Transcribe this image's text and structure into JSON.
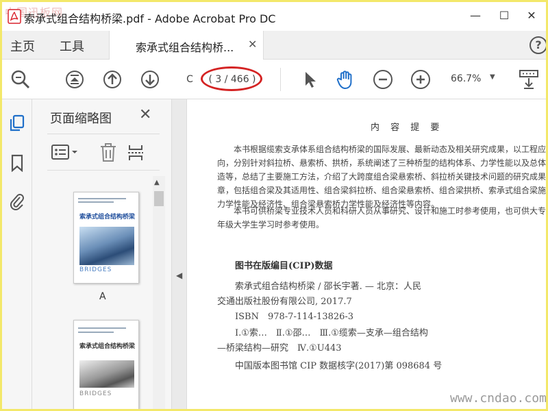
{
  "window": {
    "watermark": "中国迅板网",
    "title": "索承式组合结构桥梁.pdf - Adobe Acrobat Pro DC",
    "minimize": "—",
    "maximize": "☐",
    "close": "✕"
  },
  "tabs": {
    "home": "主页",
    "tools": "工具",
    "document_tab": "索承式组合结构桥...",
    "tab_close": "✕",
    "help": "?"
  },
  "toolbar": {
    "page_input": "C",
    "page_count": "( 3 / 466 )",
    "zoom": "66.7%",
    "zoom_caret": "▼"
  },
  "thumbnails": {
    "title": "页面缩略图",
    "close": "✕",
    "scroll_up": "▲",
    "items": [
      {
        "cover_title": "索承式组合结构桥梁",
        "cover_subtitle": "BRIDGES",
        "label": "A"
      },
      {
        "cover_title": "索承式组合结构桥梁",
        "cover_subtitle": "BRIDGES",
        "label": ""
      }
    ]
  },
  "collapse_arrow": "◀",
  "document": {
    "heading": "内 容 提 要",
    "summary_lines": [
      "　　本书根据缆索支承体系组合结构桥梁的国际发展、最新动态及相关研究成果，以工程应用",
      "向，分别针对斜拉桥、悬索桥、拱桥，系统阐述了三种桥型的结构体系、力学性能以及总体布置、结",
      "造等，总结了主要施工方法，介绍了大跨度组合梁悬索桥、斜拉桥关键技术问题的研究成果。全",
      "章，包括组合梁及其适用性、组合梁斜拉桥、组合梁悬索桥、组合梁拱桥、索承式组合梁施工方法、组",
      "力学性能及经济性、组合梁悬索桥力学性能及经济性等内容。",
      "　　本书可供桥梁专业技术人员和科研人员从事研究、设计和施工时参考使用，也可供大专院校",
      "年级大学生学习时参考使用。"
    ],
    "cip_heading": "图书在版编目(CIP)数据",
    "cip_lines": [
      "索承式组合结构桥梁 / 邵长宇著. — 北京：人民",
      "交通出版社股份有限公司, 2017.7",
      "ISBN　978-7-114-13826-3",
      "Ⅰ.①索…　Ⅱ.①邵…　Ⅲ.①缆索—支承—组合结构",
      "—桥梁结构—研究　Ⅳ.①U443",
      "中国版本图书馆 CIP 数据核字(2017)第 098684 号"
    ],
    "watermark": "www.cndao.com"
  }
}
